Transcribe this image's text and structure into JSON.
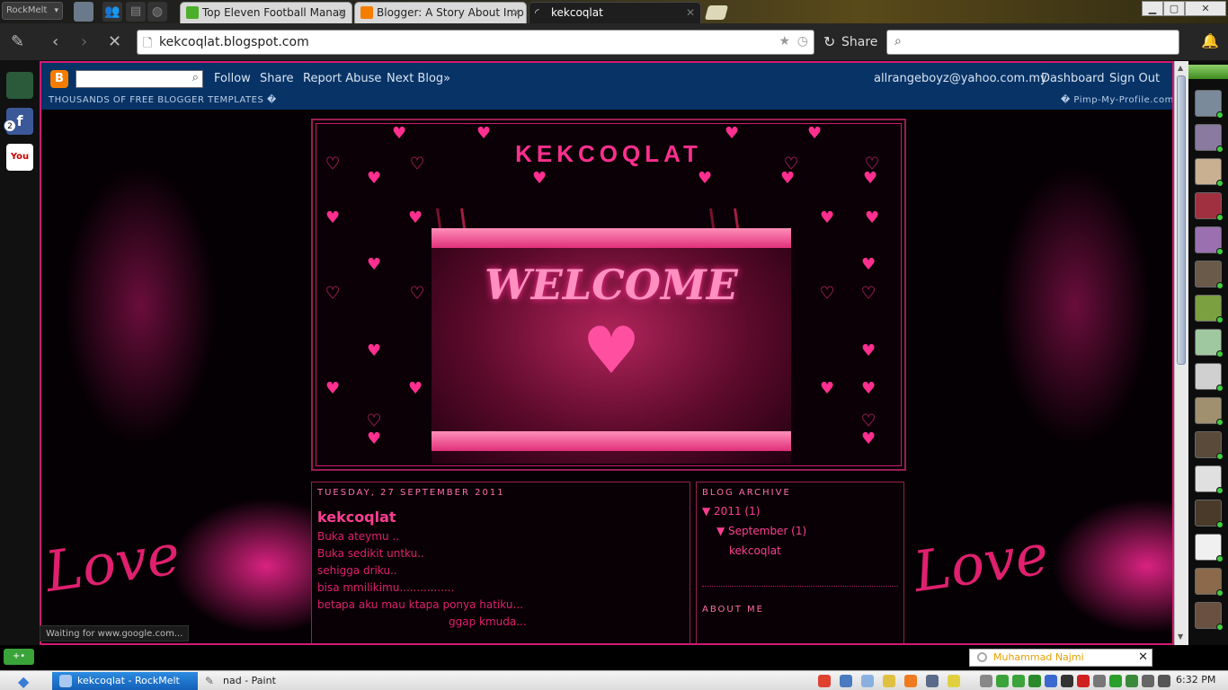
{
  "browser": {
    "menu_label": "RockMelt",
    "tabs": [
      {
        "title": "Top Eleven Football Manag",
        "icon_color": "#4caf2a"
      },
      {
        "title": "Blogger: A Story About Imp",
        "icon_color": "#f57d00"
      },
      {
        "title": "kekcoqlat",
        "icon_color": "#ffffff"
      }
    ],
    "url": "kekcoqlat.blogspot.com",
    "share_label": "Share",
    "search_placeholder": "",
    "status_text": "Waiting for www.google.com..."
  },
  "blogger_navbar": {
    "search_value": "",
    "links": [
      "Follow",
      "Share",
      "Report Abuse",
      "Next Blog»"
    ],
    "user_email": "allrangeboyz@yahoo.com.my",
    "dashboard": "Dashboard",
    "signout": "Sign Out",
    "sub_left": "THOUSANDS OF FREE BLOGGER TEMPLATES �",
    "sub_right": "� Pimp-My-Profile.com"
  },
  "blog": {
    "title": "KEKCOQLAT",
    "banner_text": "WELCOME",
    "background_script": "Love",
    "post": {
      "date": "TUESDAY, 27 SEPTEMBER 2011",
      "title": "kekcoqlat",
      "lines": [
        "Buka ateymu ..",
        "Buka sedikit untku..",
        "sehigga driku..",
        "bisa mmilikimu................",
        "betapa aku mau ktapa ponya hatiku...",
        "ggap kmuda..."
      ]
    },
    "sidebar": {
      "archive_header": "BLOG ARCHIVE",
      "year": "▼ 2011 (1)",
      "month": "▼ September (1)",
      "post_link": "kekcoqlat",
      "about_header": "ABOUT ME"
    }
  },
  "notification": {
    "name": "Muhammad Najmi"
  },
  "taskbar": {
    "items": [
      "kekcoqlat - RockMelt",
      "nad - Paint"
    ],
    "clock": "6:32 PM"
  },
  "colors": {
    "accent_pink": "#ff2f8f",
    "navbar_blue": "#083366",
    "page_bg": "#050003"
  }
}
